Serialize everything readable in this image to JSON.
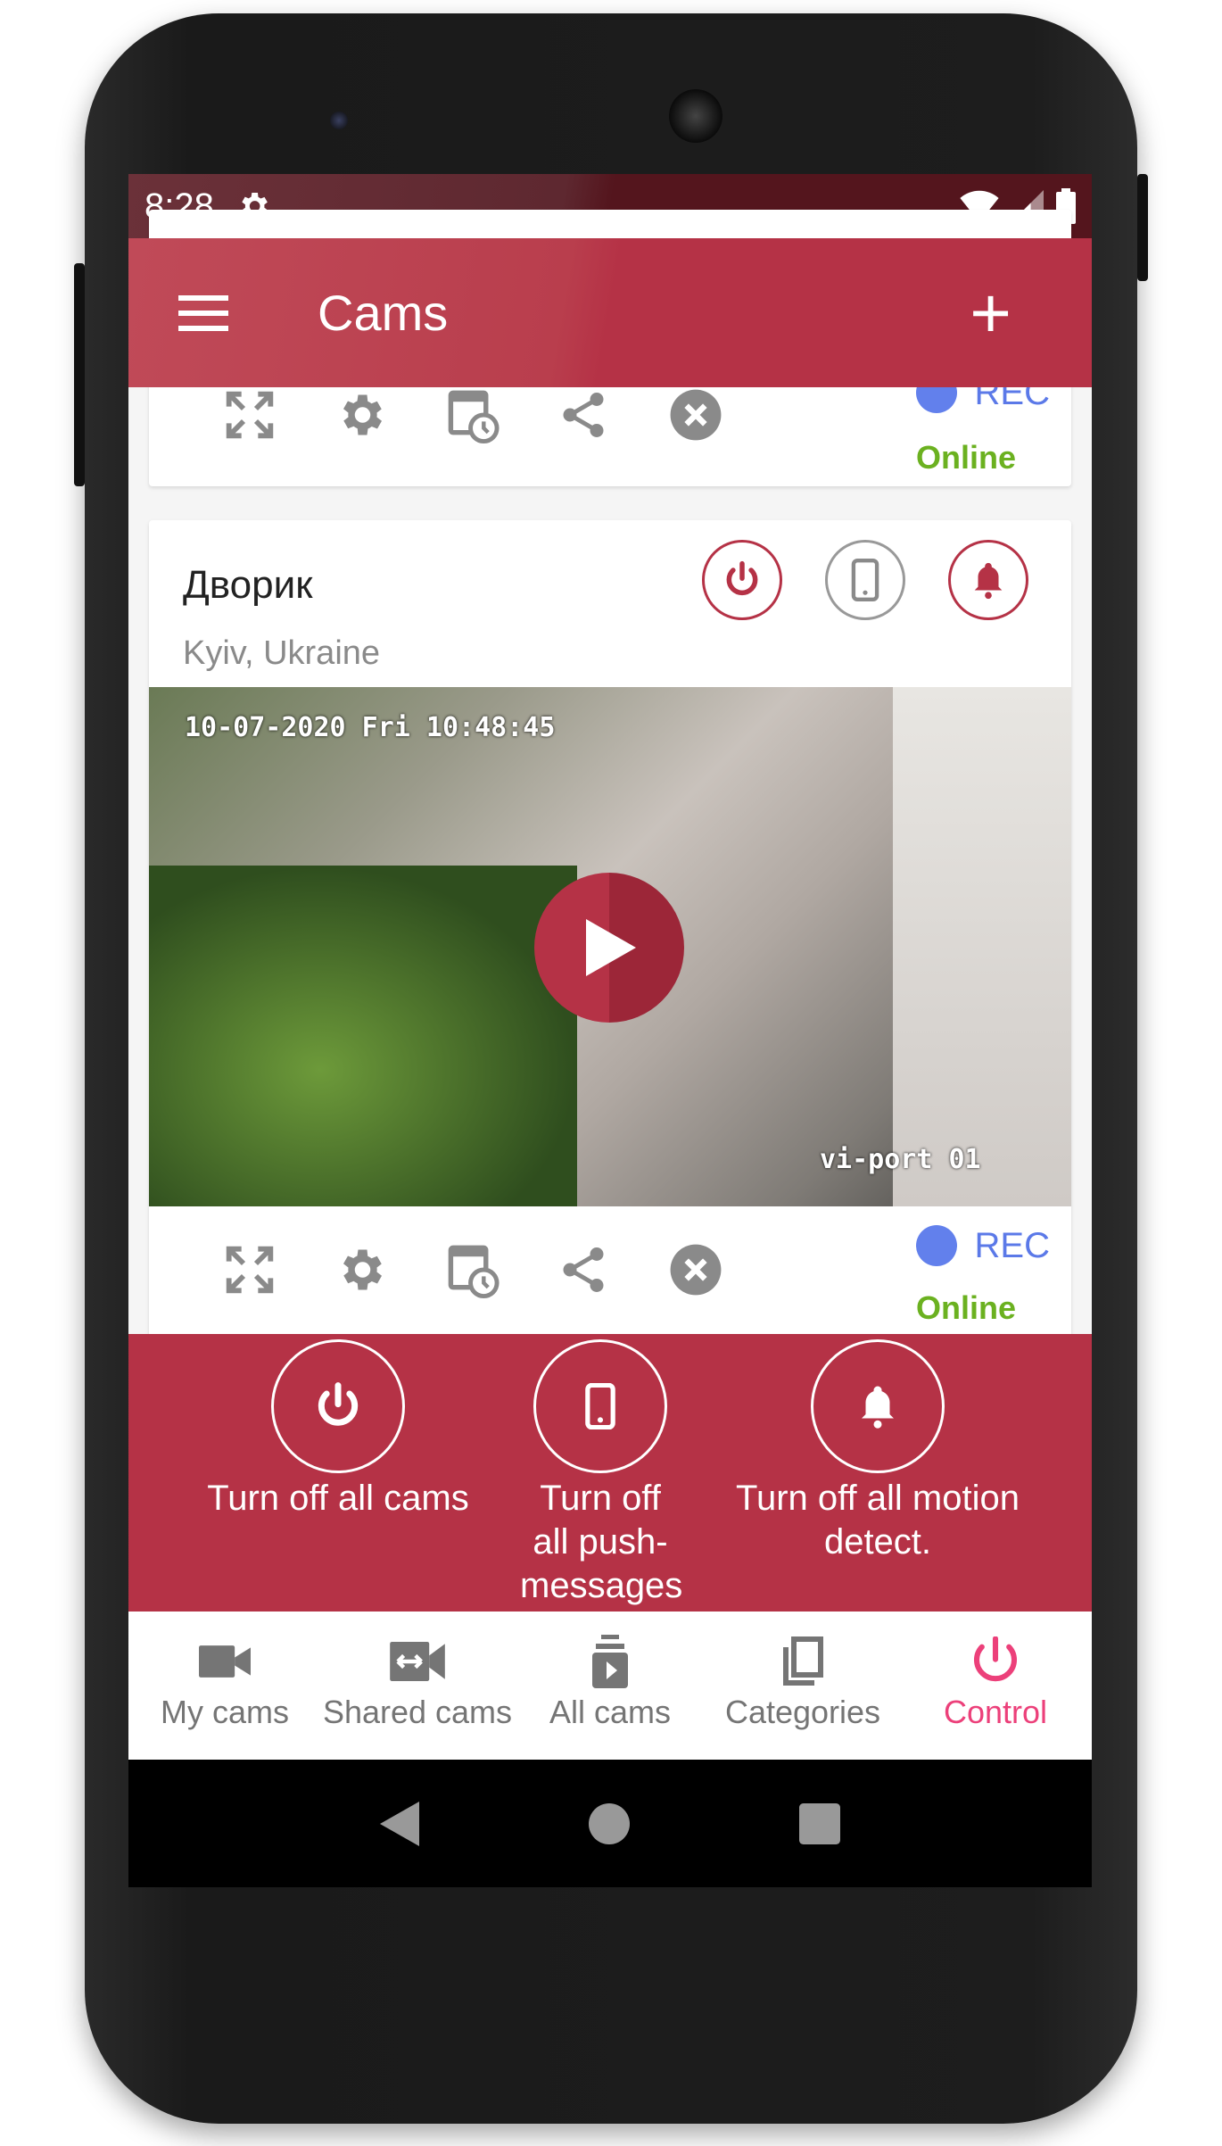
{
  "status_bar": {
    "time": "8:28"
  },
  "app_bar": {
    "title": "Cams"
  },
  "cards": [
    {
      "rec_label": "REC",
      "status": "Online"
    },
    {
      "name": "Дворик",
      "location": "Kyiv, Ukraine",
      "osd_timestamp": "10-07-2020 Fri 10:48:45",
      "osd_camera": "vi-port 01",
      "rec_label": "REC",
      "status": "Online"
    }
  ],
  "control": {
    "items": [
      {
        "label": "Turn off all cams"
      },
      {
        "label": "Turn off all push-messages"
      },
      {
        "label": "Turn off all motion detect."
      }
    ]
  },
  "bottom_nav": {
    "items": [
      {
        "label": "My cams"
      },
      {
        "label": "Shared cams"
      },
      {
        "label": "All cams"
      },
      {
        "label": "Categories"
      },
      {
        "label": "Control",
        "active": true
      }
    ]
  },
  "colors": {
    "primary": "#b53246",
    "rec": "#6280ec",
    "online": "#6bb120",
    "nav_active": "#ec407a"
  }
}
